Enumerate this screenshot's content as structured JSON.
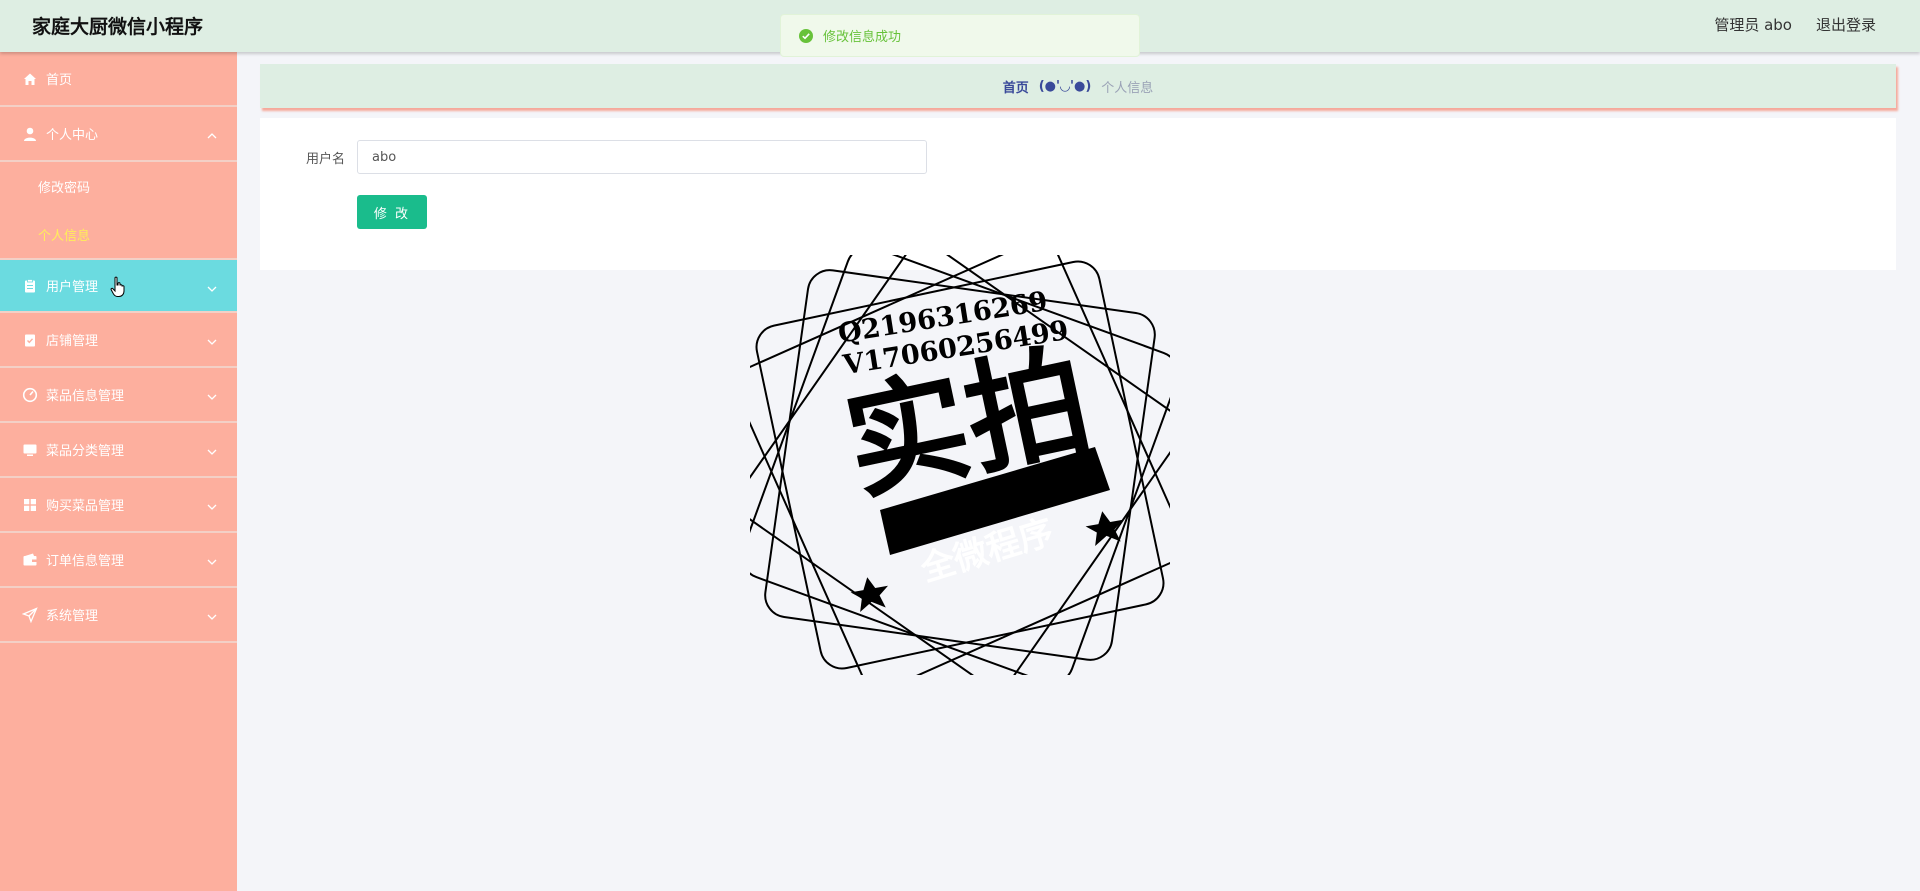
{
  "header": {
    "title": "家庭大厨微信小程序",
    "user_label": "管理员 abo",
    "logout_label": "退出登录"
  },
  "toast": {
    "message": "修改信息成功",
    "icon": "check-circle-icon",
    "color": "#67c23a"
  },
  "sidebar": {
    "items": [
      {
        "label": "首页",
        "icon": "home-icon"
      },
      {
        "label": "个人中心",
        "icon": "user-icon",
        "expanded": true,
        "children": [
          {
            "label": "修改密码"
          },
          {
            "label": "个人信息",
            "current": true
          }
        ]
      },
      {
        "label": "用户管理",
        "icon": "clipboard-icon",
        "hovered": true
      },
      {
        "label": "店铺管理",
        "icon": "clipboard-check-icon"
      },
      {
        "label": "菜品信息管理",
        "icon": "gauge-icon"
      },
      {
        "label": "菜品分类管理",
        "icon": "monitor-icon"
      },
      {
        "label": "购买菜品管理",
        "icon": "grid-icon"
      },
      {
        "label": "订单信息管理",
        "icon": "wallet-icon"
      },
      {
        "label": "系统管理",
        "icon": "send-icon"
      }
    ]
  },
  "breadcrumb": {
    "home": "首页",
    "separator": "(●'◡'●)",
    "current": "个人信息"
  },
  "form": {
    "username_label": "用户名",
    "username_value": "abo",
    "submit_label": "修 改"
  },
  "watermark": {
    "qq": "Q2196316269",
    "vx": "V17060256499",
    "title": "实拍",
    "banner": "全微程序"
  },
  "colors": {
    "header_bg": "#deeee3",
    "sidebar_bg": "#fdaf9e",
    "active_item": "#6bdbe0",
    "current_sub": "#ffee5a",
    "button": "#1abc8c",
    "page_bg": "#f4f5f9"
  }
}
